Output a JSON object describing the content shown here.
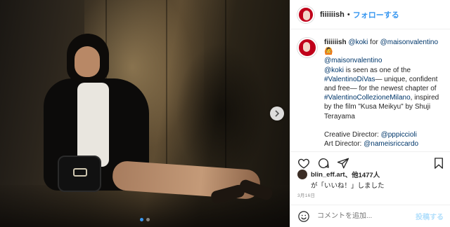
{
  "post": {
    "photo": {
      "slide_count": 2,
      "active_slide": 1
    },
    "header": {
      "username": "fiiiiiish",
      "separator": "•",
      "follow_label": "フォローする"
    },
    "caption": {
      "username": "fiiiiiish",
      "lines": [
        "@koki for @maisonvalentino",
        "🙆",
        "@maisonvalentino",
        "@koki is seen as one of the",
        "#ValentinoDiVas— unique, confident",
        "and free— for the newest chapter of",
        "#ValentinoCollezioneMilano, inspired",
        "by the film \"Kusa Meikyu\" by Shuji",
        "Terayama",
        "",
        "Creative Director: @pppiccioli",
        "Art Director: @nameisriccardo"
      ]
    },
    "likes": {
      "liker": "blin_eff.art",
      "others": "、他1477人",
      "suffix": "が「いいね！」しました"
    },
    "date": "3月16日",
    "comment": {
      "placeholder": "コメントを追加...",
      "post_label": "投稿する"
    }
  },
  "colors": {
    "accent": "#3897f0",
    "link": "#00376b",
    "post_disabled": "#b2dffc",
    "avatar": "#c0001a"
  },
  "icons": [
    "heart-icon",
    "comment-icon",
    "share-icon",
    "bookmark-icon",
    "smile-icon",
    "chevron-right-icon"
  ]
}
